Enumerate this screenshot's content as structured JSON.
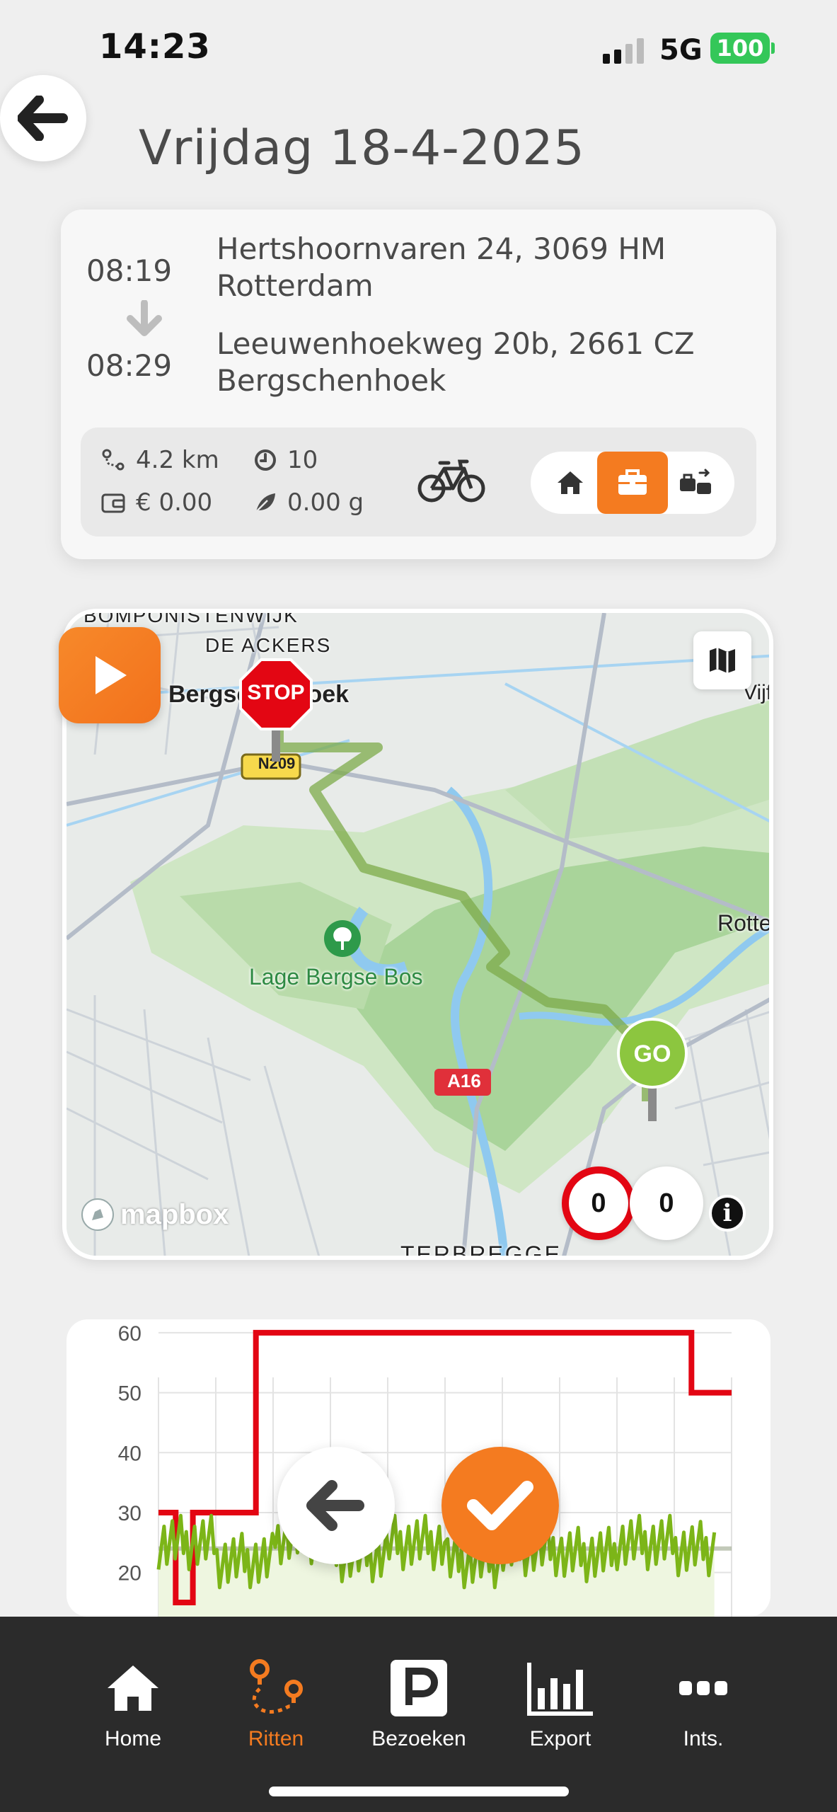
{
  "status_bar": {
    "time": "14:23",
    "network": "5G",
    "battery": "100"
  },
  "header": {
    "title": "Vrijdag 18-4-2025"
  },
  "trip": {
    "start_time": "08:19",
    "end_time": "08:29",
    "from_address": "Hertshoornvaren 24, 3069 HM Rotterdam",
    "to_address": "Leeuwenhoekweg 20b, 2661 CZ Bergschenhoek",
    "distance": "4.2 km",
    "duration": "10",
    "cost": "€ 0.00",
    "emission": "0.00 g",
    "vehicle_icon": "bicycle-icon",
    "purpose_options": [
      "home",
      "work",
      "business"
    ],
    "selected_purpose": "work"
  },
  "map": {
    "labels": {
      "top_left": "BOMPONISTENWIJK",
      "de_ackers": "DE ACKERS",
      "bergschenhoek": "Bergschenhoek",
      "road_n209": "N209",
      "lage_bergse_bos": "Lage Bergse Bos",
      "road_a16": "A16",
      "rotterdam": "Rotte",
      "vijf": "Vijf",
      "terbregge": "TERBREGGE"
    },
    "stop_pin": "STOP",
    "go_pin": "GO",
    "speed_counter_red": "0",
    "speed_counter": "0",
    "attribution": "mapbox"
  },
  "chart_data": {
    "type": "line",
    "ylim": [
      15,
      62
    ],
    "yticks": [
      "60",
      "50",
      "40",
      "30",
      "20"
    ],
    "series": [
      {
        "color": "#e30613",
        "x": [
          0,
          0.3,
          0.3,
          0.6,
          0.6,
          1.7,
          1.7,
          9.3,
          9.3,
          10
        ],
        "y": [
          30,
          30,
          15,
          15,
          30,
          30,
          60,
          60,
          50,
          50
        ]
      },
      {
        "color": "#7cb518",
        "x": [
          0,
          1,
          2,
          3,
          4,
          5,
          6,
          7,
          8,
          9,
          9.7
        ],
        "y": [
          25,
          22,
          26,
          23,
          25,
          22,
          24,
          23,
          25,
          24,
          26
        ]
      }
    ],
    "reference_line": 24
  },
  "colors": {
    "accent": "#f47b20",
    "stop": "#e30613",
    "go": "#8cc63f",
    "nav_bg": "#2b2b2b"
  },
  "nav": {
    "items": [
      {
        "label": "Home",
        "icon": "home-icon"
      },
      {
        "label": "Ritten",
        "icon": "route-icon"
      },
      {
        "label": "Bezoeken",
        "icon": "parking-icon"
      },
      {
        "label": "Export",
        "icon": "bar-chart-icon"
      },
      {
        "label": "Ints.",
        "icon": "more-icon"
      }
    ],
    "active": "Ritten"
  }
}
